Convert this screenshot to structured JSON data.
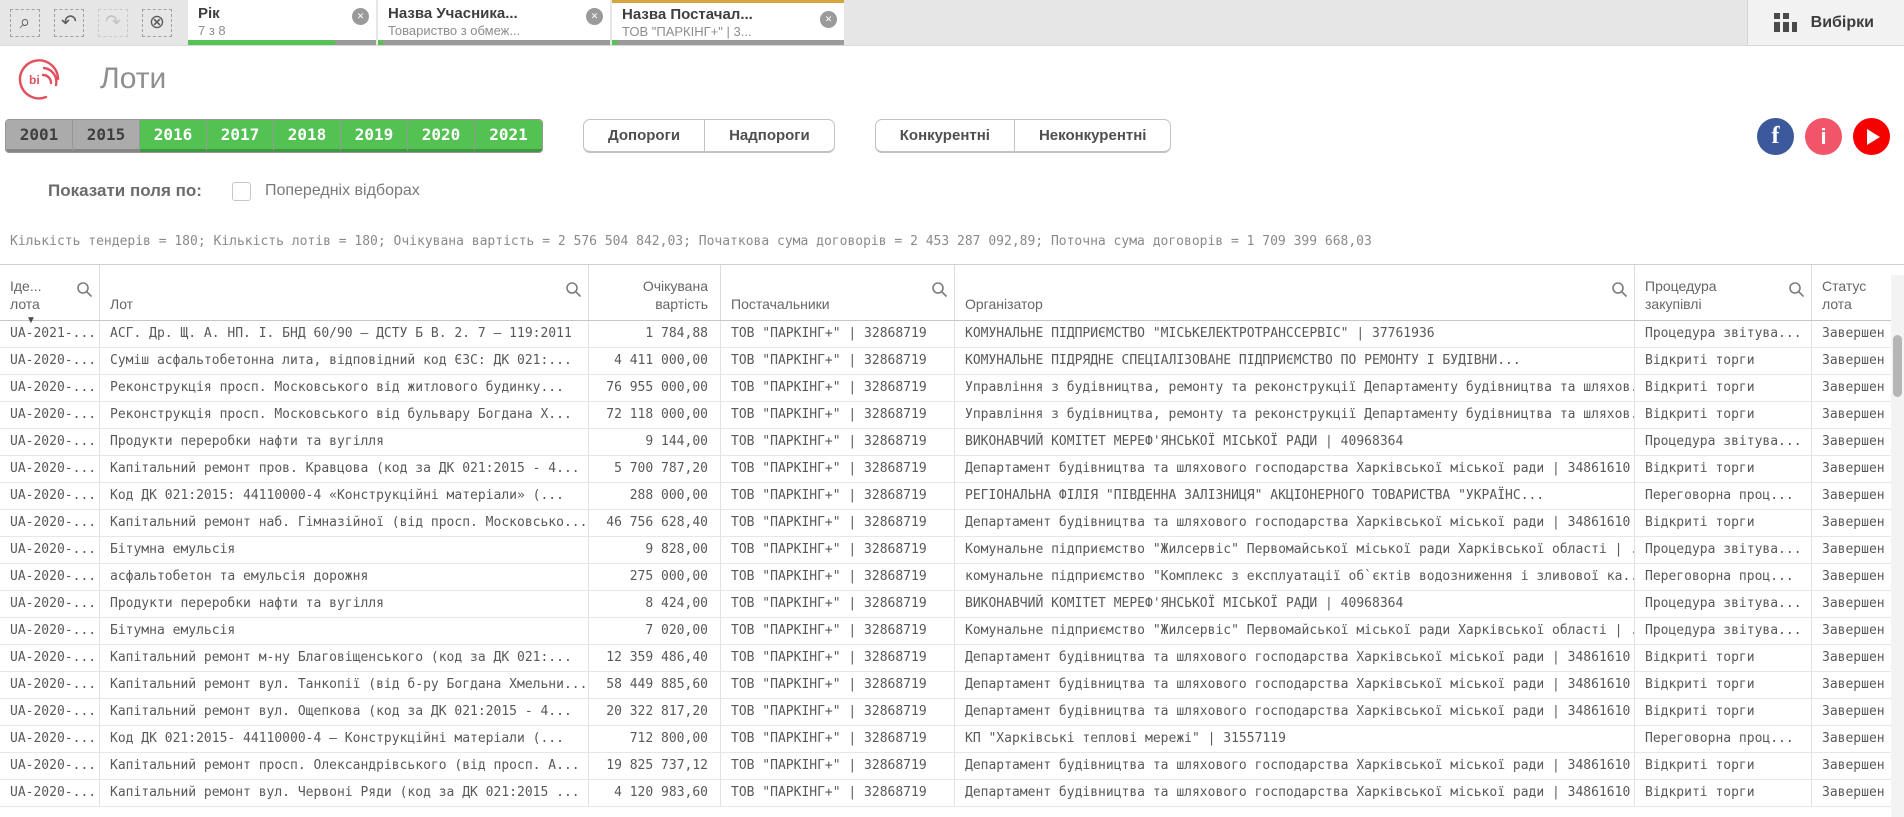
{
  "topbar": {
    "toolbar": [
      {
        "name": "smart-search",
        "glyph": "⌕"
      },
      {
        "name": "step-back",
        "glyph": "↶"
      },
      {
        "name": "step-forward",
        "glyph": "↷",
        "disabled": true
      },
      {
        "name": "clear-selections",
        "glyph": "⊗"
      }
    ],
    "chips": [
      {
        "title": "Рік",
        "subtitle": "7 з 8",
        "green_pct": 78,
        "orange_top": false
      },
      {
        "title": "Назва Учасника...",
        "subtitle": "Товариство з обмеж...",
        "green_pct": 2,
        "orange_top": false
      },
      {
        "title": "Назва Постачал...",
        "subtitle": "ТОВ \"ПАРКІНГ+\" | 3...",
        "green_pct": 2,
        "orange_top": true
      }
    ],
    "selections_label": "Вибірки",
    "close_glyph": "✕"
  },
  "header": {
    "title": "Лоти",
    "logo_text": "bi"
  },
  "filters": {
    "years": [
      {
        "label": "2001",
        "selected": false
      },
      {
        "label": "2015",
        "selected": false
      },
      {
        "label": "2016",
        "selected": true
      },
      {
        "label": "2017",
        "selected": true
      },
      {
        "label": "2018",
        "selected": true
      },
      {
        "label": "2019",
        "selected": true
      },
      {
        "label": "2020",
        "selected": true
      },
      {
        "label": "2021",
        "selected": true
      }
    ],
    "threshold_buttons": [
      "Допороги",
      "Надпороги"
    ],
    "competition_buttons": [
      "Конкурентні",
      "Неконкурентні"
    ],
    "social_icons": [
      "facebook",
      "instagram",
      "youtube"
    ]
  },
  "show_fields": {
    "label": "Показати поля по:",
    "checkbox_label": "Попередніх відборах",
    "checked": false
  },
  "summary": "Кількість тендерів = 180; Кількість лотів = 180; Очікувана вартість = 2 576 504 842,03; Початкова сума договорів = 2 453 287 092,89; Поточна сума договорів = 1 709 399 668,03",
  "table": {
    "columns": [
      {
        "label": "Іде...",
        "label2": "лота"
      },
      {
        "label": "Лот"
      },
      {
        "label": "Очікувана",
        "label2": "вартість"
      },
      {
        "label": "Постачальники"
      },
      {
        "label": "Організатор"
      },
      {
        "label": "Процедура",
        "label2": "закупівлі"
      },
      {
        "label": "Статус",
        "label2": "лота"
      }
    ],
    "rows": [
      {
        "id": "UA-2021-...",
        "lot": "АСГ. Др. Щ. А. НП. І. БНД 60/90 – ДСТУ Б В. 2. 7 – 119:2011",
        "value": "1 784,88",
        "supplier": "ТОВ \"ПАРКІНГ+\" | 32868719",
        "organizer": "КОМУНАЛЬНЕ ПІДПРИЄМСТВО \"МІСЬКЕЛЕКТРОТРАНССЕРВІС\" | 37761936",
        "procedure": "Процедура звітува...",
        "status": "Завершен"
      },
      {
        "id": "UA-2020-...",
        "lot": "Суміш асфальтобетонна лита, відповідний код ЄЗС: ДК 021:...",
        "value": "4 411 000,00",
        "supplier": "ТОВ \"ПАРКІНГ+\" | 32868719",
        "organizer": "КОМУНАЛЬНЕ ПІДРЯДНЕ СПЕЦІАЛІЗОВАНЕ ПІДПРИЄМСТВО ПО РЕМОНТУ І БУДІВНИ...",
        "procedure": "Відкриті торги",
        "status": "Завершен"
      },
      {
        "id": "UA-2020-...",
        "lot": "Реконструкція просп. Московського від житлового будинку...",
        "value": "76 955 000,00",
        "supplier": "ТОВ \"ПАРКІНГ+\" | 32868719",
        "organizer": "Управління з будівництва, ремонту та реконструкції Департаменту будівництва та шляхов...",
        "procedure": "Відкриті торги",
        "status": "Завершен"
      },
      {
        "id": "UA-2020-...",
        "lot": "Реконструкція просп. Московського від бульвару Богдана Х...",
        "value": "72 118 000,00",
        "supplier": "ТОВ \"ПАРКІНГ+\" | 32868719",
        "organizer": "Управління з будівництва, ремонту та реконструкції Департаменту будівництва та шляхов...",
        "procedure": "Відкриті торги",
        "status": "Завершен"
      },
      {
        "id": "UA-2020-...",
        "lot": "Продукти переробки нафти та вугілля",
        "value": "9 144,00",
        "supplier": "ТОВ \"ПАРКІНГ+\" | 32868719",
        "organizer": "ВИКОНАВЧИЙ КОМІТЕТ МЕРЕФ'ЯНСЬКОЇ МІСЬКОЇ РАДИ | 40968364",
        "procedure": "Процедура звітува...",
        "status": "Завершен"
      },
      {
        "id": "UA-2020-...",
        "lot": "Капітальний ремонт пров. Кравцова (код за ДК 021:2015 - 4...",
        "value": "5 700 787,20",
        "supplier": "ТОВ \"ПАРКІНГ+\" | 32868719",
        "organizer": "Департамент будівництва та шляхового господарства Харківської міської ради | 34861610",
        "procedure": "Відкриті торги",
        "status": "Завершен"
      },
      {
        "id": "UA-2020-...",
        "lot": "Код ДК 021:2015: 44110000-4 «Конструкційні матеріали» (...",
        "value": "288 000,00",
        "supplier": "ТОВ \"ПАРКІНГ+\" | 32868719",
        "organizer": "РЕГІОНАЛЬНА ФІЛІЯ \"ПІВДЕННА ЗАЛІЗНИЦЯ\" АКЦІОНЕРНОГО ТОВАРИСТВА \"УКРАЇНС...",
        "procedure": "Переговорна проц...",
        "status": "Завершен"
      },
      {
        "id": "UA-2020-...",
        "lot": "Капітальний ремонт наб. Гімназійної (від просп. Московсько...",
        "value": "46 756 628,40",
        "supplier": "ТОВ \"ПАРКІНГ+\" | 32868719",
        "organizer": "Департамент будівництва та шляхового господарства Харківської міської ради | 34861610",
        "procedure": "Відкриті торги",
        "status": "Завершен"
      },
      {
        "id": "UA-2020-...",
        "lot": "Бітумна емульсія",
        "value": "9 828,00",
        "supplier": "ТОВ \"ПАРКІНГ+\" | 32868719",
        "organizer": "Комунальне підприємство \"Жилсервіс\" Первомайської міської ради Харківської області | ...",
        "procedure": "Процедура звітува...",
        "status": "Завершен"
      },
      {
        "id": "UA-2020-...",
        "lot": "асфальтобетон та емульсія дорожня",
        "value": "275 000,00",
        "supplier": "ТОВ \"ПАРКІНГ+\" | 32868719",
        "organizer": "комунальне підприємство \"Комплекс з експлуатації об`єктів водозниження і зливової ка...",
        "procedure": "Переговорна проц...",
        "status": "Завершен"
      },
      {
        "id": "UA-2020-...",
        "lot": "Продукти переробки нафти та вугілля",
        "value": "8 424,00",
        "supplier": "ТОВ \"ПАРКІНГ+\" | 32868719",
        "organizer": "ВИКОНАВЧИЙ КОМІТЕТ МЕРЕФ'ЯНСЬКОЇ МІСЬКОЇ РАДИ | 40968364",
        "procedure": "Процедура звітува...",
        "status": "Завершен"
      },
      {
        "id": "UA-2020-...",
        "lot": "Бітумна емульсія",
        "value": "7 020,00",
        "supplier": "ТОВ \"ПАРКІНГ+\" | 32868719",
        "organizer": "Комунальне підприємство \"Жилсервіс\" Первомайської міської ради Харківської області | ...",
        "procedure": "Процедура звітува...",
        "status": "Завершен"
      },
      {
        "id": "UA-2020-...",
        "lot": "Капітальний ремонт м-ну Благовіщенського (код за ДК 021:...",
        "value": "12 359 486,40",
        "supplier": "ТОВ \"ПАРКІНГ+\" | 32868719",
        "organizer": "Департамент будівництва та шляхового господарства Харківської міської ради | 34861610",
        "procedure": "Відкриті торги",
        "status": "Завершен"
      },
      {
        "id": "UA-2020-...",
        "lot": "Капітальний ремонт вул. Танкопії (від б-ру Богдана Хмельни...",
        "value": "58 449 885,60",
        "supplier": "ТОВ \"ПАРКІНГ+\" | 32868719",
        "organizer": "Департамент будівництва та шляхового господарства Харківської міської ради | 34861610",
        "procedure": "Відкриті торги",
        "status": "Завершен"
      },
      {
        "id": "UA-2020-...",
        "lot": "Капітальний ремонт вул. Ощепкова (код за ДК 021:2015 - 4...",
        "value": "20 322 817,20",
        "supplier": "ТОВ \"ПАРКІНГ+\" | 32868719",
        "organizer": "Департамент будівництва та шляхового господарства Харківської міської ради | 34861610",
        "procedure": "Відкриті торги",
        "status": "Завершен"
      },
      {
        "id": "UA-2020-...",
        "lot": "Код ДК 021:2015- 44110000-4 — Конструкційні матеріали (...",
        "value": "712 800,00",
        "supplier": "ТОВ \"ПАРКІНГ+\" | 32868719",
        "organizer": "КП \"Харківські теплові мережі\" | 31557119",
        "procedure": "Переговорна проц...",
        "status": "Завершен"
      },
      {
        "id": "UA-2020-...",
        "lot": "Капітальний ремонт просп. Олександрівського (від просп. А...",
        "value": "19 825 737,12",
        "supplier": "ТОВ \"ПАРКІНГ+\" | 32868719",
        "organizer": "Департамент будівництва та шляхового господарства Харківської міської ради | 34861610",
        "procedure": "Відкриті торги",
        "status": "Завершен"
      },
      {
        "id": "UA-2020-...",
        "lot": "Капітальний ремонт вул. Червоні Ряди (код за ДК 021:2015 ...",
        "value": "4 120 983,60",
        "supplier": "ТОВ \"ПАРКІНГ+\" | 32868719",
        "organizer": "Департамент будівництва та шляхового господарства Харківської міської ради | 34861610",
        "procedure": "Відкриті торги",
        "status": "Завершен"
      }
    ]
  },
  "colors": {
    "selection_green": "#54c254",
    "excluded_gray": "#9a9a9a",
    "locked_orange": "#d4a53a",
    "brand_red": "#e2505e",
    "facebook_blue": "#3a589b",
    "instagram_pink": "#f0556a",
    "youtube_red": "#f70000"
  }
}
